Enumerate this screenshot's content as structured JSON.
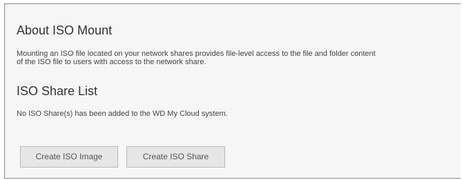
{
  "about": {
    "title": "About ISO Mount",
    "description_line1": "Mounting an ISO file located on your network shares provides file-level access to the file and folder content",
    "description_line2": "of the ISO file to users with access to the network share."
  },
  "share_list": {
    "title": "ISO Share List",
    "empty_message": "No ISO Share(s) has been added to the WD My Cloud system."
  },
  "buttons": {
    "create_image": "Create ISO Image",
    "create_share": "Create ISO Share"
  },
  "colors": {
    "panel_background": "#f6f6f6",
    "button_background": "#e6e6e6",
    "border": "#8a8a8a"
  }
}
